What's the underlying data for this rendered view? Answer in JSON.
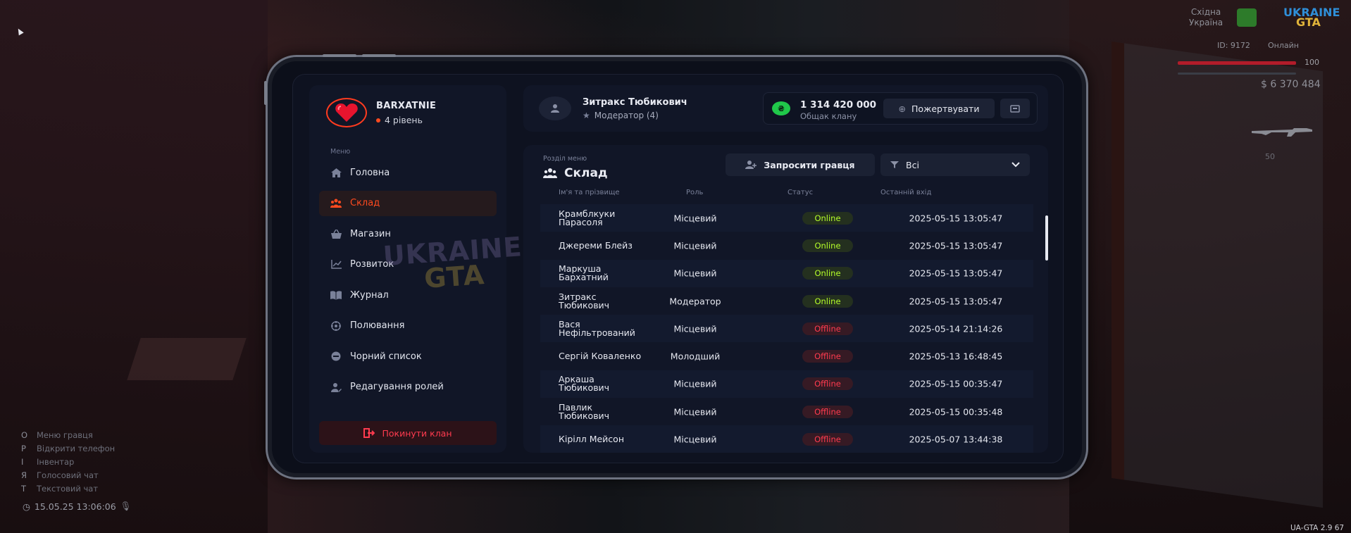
{
  "clan": {
    "name": "BARXATNIE",
    "level": "4 рівень"
  },
  "menu": {
    "caption": "Меню",
    "items": [
      {
        "label": "Головна",
        "icon": "home-icon",
        "active": false
      },
      {
        "label": "Склад",
        "icon": "users-icon",
        "active": true
      },
      {
        "label": "Магазин",
        "icon": "basket-icon",
        "active": false
      },
      {
        "label": "Розвиток",
        "icon": "chart-icon",
        "active": false
      },
      {
        "label": "Журнал",
        "icon": "book-icon",
        "active": false
      },
      {
        "label": "Полювання",
        "icon": "target-icon",
        "active": false
      },
      {
        "label": "Чорний список",
        "icon": "block-icon",
        "active": false
      },
      {
        "label": "Редагування ролей",
        "icon": "user-edit-icon",
        "active": false
      }
    ],
    "leave_label": "Покинути клан"
  },
  "header": {
    "user_name": "Зитракс Тюбикович",
    "user_role": "Модератор (4)",
    "bank_amount": "1 314 420 000",
    "bank_label": "Общак клану",
    "donate_label": "Пожертвувати"
  },
  "section": {
    "caption": "Розділ меню",
    "title": "Склад",
    "invite_label": "Запросити гравця",
    "filter_value": "Всі"
  },
  "table": {
    "columns": [
      "Ім'я та прізвище",
      "Роль",
      "Статус",
      "Останній вхід"
    ],
    "rows": [
      {
        "name": "Крамблкуки Парасоля",
        "role": "Місцевий",
        "status": "Online",
        "last": "2025-05-15 13:05:47"
      },
      {
        "name": "Джереми Блейз",
        "role": "Місцевий",
        "status": "Online",
        "last": "2025-05-15 13:05:47"
      },
      {
        "name": "Маркуша Бархатний",
        "role": "Місцевий",
        "status": "Online",
        "last": "2025-05-15 13:05:47"
      },
      {
        "name": "Зитракс Тюбикович",
        "role": "Модератор",
        "status": "Online",
        "last": "2025-05-15 13:05:47"
      },
      {
        "name": "Вася Нефільтрований",
        "role": "Місцевий",
        "status": "Offline",
        "last": "2025-05-14 21:14:26"
      },
      {
        "name": "Сергій Коваленко",
        "role": "Молодший",
        "status": "Offline",
        "last": "2025-05-13 16:48:45"
      },
      {
        "name": "Аркаша Тюбикович",
        "role": "Місцевий",
        "status": "Offline",
        "last": "2025-05-15 00:35:47"
      },
      {
        "name": "Павлик Тюбикович",
        "role": "Місцевий",
        "status": "Offline",
        "last": "2025-05-15 00:35:48"
      },
      {
        "name": "Кірілл Мейсон",
        "role": "Місцевий",
        "status": "Offline",
        "last": "2025-05-07 13:44:38"
      }
    ]
  },
  "watermark": {
    "line1": "UKRAINE",
    "line2": "GTA"
  },
  "hud": {
    "region_line1": "Східна",
    "region_line2": "Україна",
    "logo_line1": "UKRAINE",
    "logo_line2": "GTA",
    "player_id": "ID: 9172",
    "online": "Онлайн",
    "hp": "100",
    "money": "$ 6 370 484",
    "ammo": "50",
    "keys": [
      {
        "key": "O",
        "label": "Меню гравця"
      },
      {
        "key": "P",
        "label": "Відкрити телефон"
      },
      {
        "key": "I",
        "label": "Інвентар"
      },
      {
        "key": "Я",
        "label": "Голосовий чат"
      },
      {
        "key": "T",
        "label": "Текстовий чат"
      }
    ],
    "datetime": "15.05.25 13:06:06",
    "version": "UA-GTA 2.9 67"
  },
  "colors": {
    "accent": "#ff4a1f",
    "online": "#b6ff2a",
    "offline": "#ff3b4f",
    "panel": "#111627"
  }
}
